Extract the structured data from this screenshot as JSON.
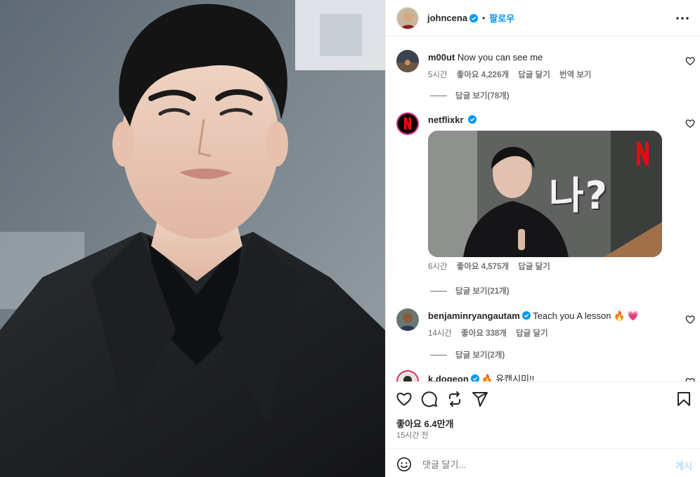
{
  "post": {
    "author": "johncena",
    "separator": "•",
    "follow_label": "팔로우"
  },
  "comments": [
    {
      "user": "m00ut",
      "text": "Now you can see me",
      "time": "5시간",
      "likes": "좋아요 4,226개",
      "reply": "답글 달기",
      "translate": "번역 보기",
      "view_replies": "답글 보기(78개)"
    },
    {
      "user": "netflixkr",
      "image_text": "나?",
      "time": "6시간",
      "likes": "좋아요 4,575개",
      "reply": "답글 달기",
      "view_replies": "답글 보기(21개)"
    },
    {
      "user": "benjaminryangautam",
      "text": "Teach you A lesson",
      "emoji": "🔥 💗",
      "time": "14시간",
      "likes": "좋아요 338개",
      "reply": "답글 달기",
      "view_replies": "답글 보기(2개)"
    },
    {
      "user": "k.dogeon",
      "text": "🔥 유캔시미!!"
    }
  ],
  "footer": {
    "likes": "좋아요 6.4만개",
    "time": "15시간 전"
  },
  "composer": {
    "placeholder": "댓글 달기...",
    "post_label": "게시"
  },
  "colors": {
    "accent": "#0095f6",
    "verified": "#0095f6",
    "netflix_red": "#e50914"
  },
  "icons": [
    "verified-badge-icon",
    "more-options-icon",
    "heart-outline-icon",
    "comment-icon",
    "repost-icon",
    "share-icon",
    "bookmark-icon",
    "emoji-icon"
  ]
}
